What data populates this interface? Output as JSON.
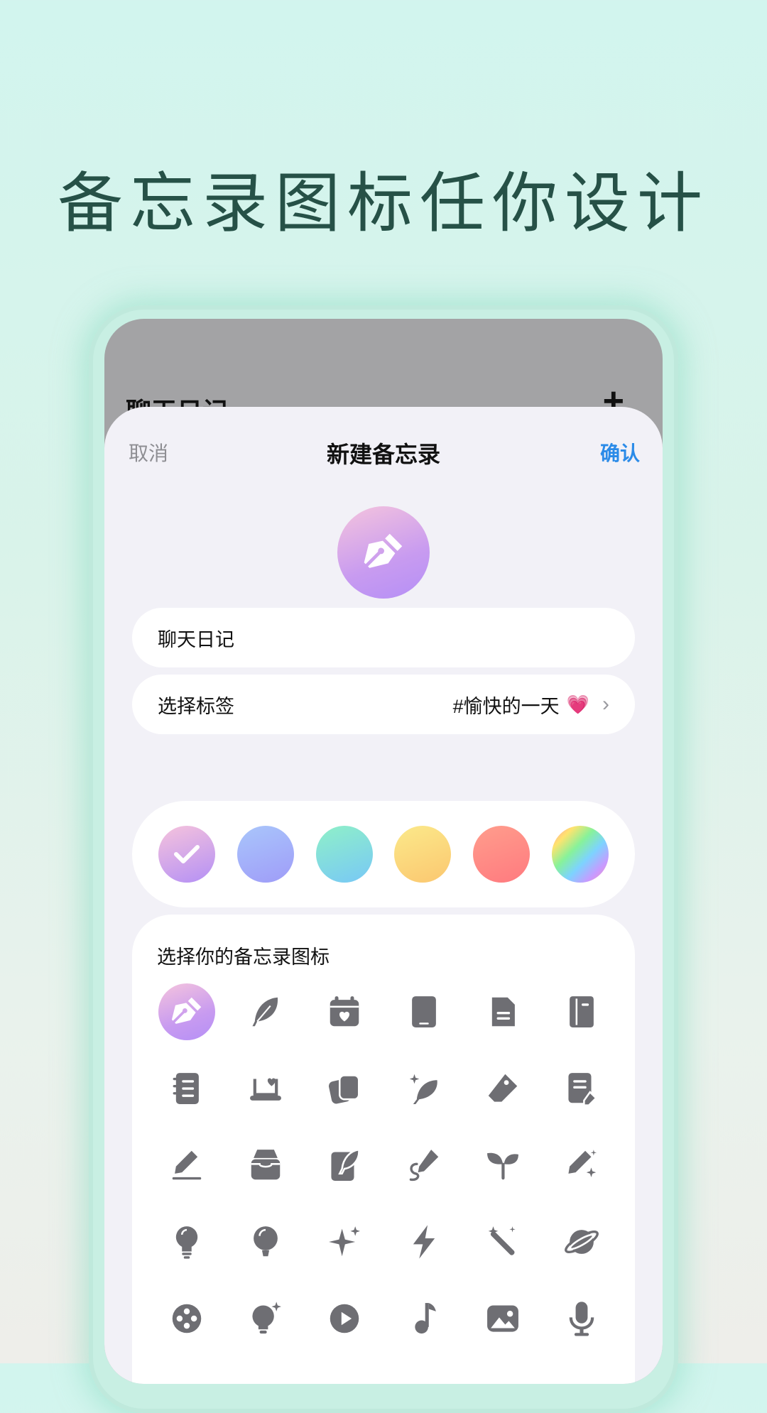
{
  "headline": "备忘录图标任你设计",
  "background_screen": {
    "title": "聊天日记",
    "plus_label": "+"
  },
  "nav": {
    "cancel": "取消",
    "title": "新建备忘录",
    "confirm": "确认"
  },
  "name_field": {
    "value": "聊天日记"
  },
  "tag_field": {
    "label": "选择标签",
    "value": "#愉快的一天",
    "emoji": "💗",
    "chevron": "›"
  },
  "colors": {
    "swatches": [
      "pink-purple",
      "blue",
      "mint",
      "yellow",
      "coral",
      "rainbow"
    ],
    "selected": "pink-purple"
  },
  "icon_picker": {
    "title": "选择你的备忘录图标",
    "selected": "pen-nib-icon",
    "icons": [
      "pen-nib-icon",
      "feather-icon",
      "calendar-heart-icon",
      "tablet-icon",
      "document-icon",
      "notebook-icon",
      "spiral-notebook-icon",
      "laptop-heart-icon",
      "cards-icon",
      "sparkle-feather-icon",
      "eraser-icon",
      "note-edit-icon",
      "pencil-line-icon",
      "archive-icon",
      "notepad-feather-icon",
      "pencil-squiggle-icon",
      "sprout-icon",
      "magic-pencil-icon",
      "bulb-icon",
      "balloon-icon",
      "sparkle-icon",
      "lightning-icon",
      "magic-wand-icon",
      "planet-icon",
      "film-reel-icon",
      "bulb-sparkle-icon",
      "play-icon",
      "music-note-icon",
      "image-icon",
      "microphone-icon"
    ]
  },
  "colors_hex": {
    "icon_gray": "#6e6e73",
    "accent_blue": "#2b8be8",
    "headline": "#265147"
  }
}
